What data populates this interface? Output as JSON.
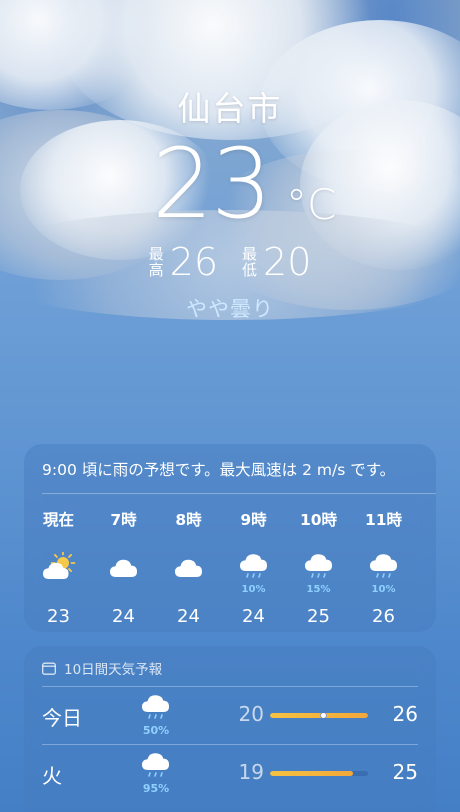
{
  "location": {
    "city": "仙台市",
    "temperature": "23",
    "unit": "°C",
    "high_label_1": "最",
    "high_label_2": "高",
    "high": "26",
    "low_label_1": "最",
    "low_label_2": "低",
    "low": "20",
    "condition": "やや曇り"
  },
  "hourly": {
    "summary": "9:00 頃に雨の予想です。最大風速は 2 m/s です。",
    "items": [
      {
        "time": "現在",
        "icon": "partly-sunny-icon",
        "precip": "",
        "temp": "23"
      },
      {
        "time": "7時",
        "icon": "cloud-icon",
        "precip": "",
        "temp": "24"
      },
      {
        "time": "8時",
        "icon": "cloud-icon",
        "precip": "",
        "temp": "24"
      },
      {
        "time": "9時",
        "icon": "rain-cloud-icon",
        "precip": "10%",
        "temp": "24"
      },
      {
        "time": "10時",
        "icon": "rain-cloud-icon",
        "precip": "15%",
        "temp": "25"
      },
      {
        "time": "11時",
        "icon": "rain-cloud-icon",
        "precip": "10%",
        "temp": "26"
      }
    ]
  },
  "daily": {
    "header": "10日間天気予報",
    "rows": [
      {
        "day": "今日",
        "icon": "rain-cloud-icon",
        "precip": "50%",
        "low": "20",
        "high": "26",
        "range_start": 0.0,
        "range_end": 1.0,
        "current": 0.55
      },
      {
        "day": "火",
        "icon": "rain-cloud-icon",
        "precip": "95%",
        "low": "19",
        "high": "25",
        "range_start": 0.0,
        "range_end": 0.85,
        "current": null
      }
    ]
  },
  "colors": {
    "precip_text": "#8fd0ff",
    "temp_bar": "#f5c242",
    "condition_text": "#cfe8ff"
  }
}
